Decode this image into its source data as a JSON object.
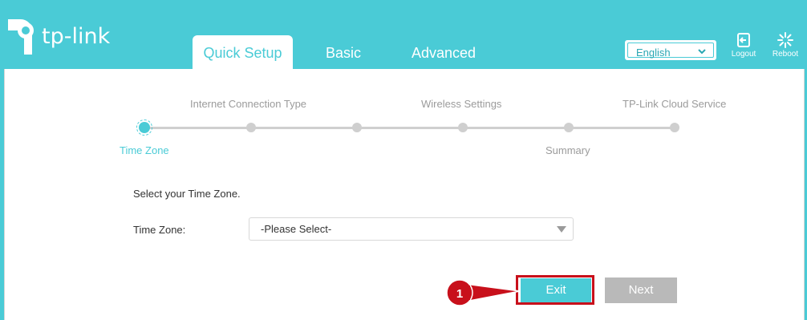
{
  "header": {
    "brand": "tp-link",
    "tabs": [
      {
        "label": "Quick Setup",
        "active": true
      },
      {
        "label": "Basic",
        "active": false
      },
      {
        "label": "Advanced",
        "active": false
      }
    ],
    "language": "English",
    "logout_label": "Logout",
    "reboot_label": "Reboot"
  },
  "wizard": {
    "steps_top": [
      "Internet Connection Type",
      "Wireless Settings",
      "TP-Link Cloud Service"
    ],
    "steps_bottom": [
      "Time Zone",
      "Summary"
    ],
    "active_step": "Time Zone"
  },
  "form": {
    "instruction": "Select your Time Zone.",
    "timezone_label": "Time Zone:",
    "timezone_value": "-Please Select-"
  },
  "actions": {
    "exit_label": "Exit",
    "next_label": "Next"
  },
  "annotation": {
    "number": "1"
  },
  "colors": {
    "accent": "#4acbd6",
    "highlight": "#c8101b",
    "disabled": "#b9b9b9"
  }
}
